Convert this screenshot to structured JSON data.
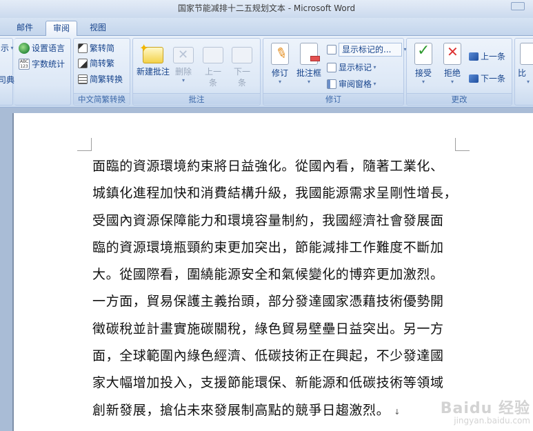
{
  "window": {
    "title": "国家节能减排十二五规划文本 - Microsoft Word"
  },
  "tabs": [
    {
      "label": "邮件"
    },
    {
      "label": "审阅",
      "active": true
    },
    {
      "label": "视图"
    }
  ],
  "ribbon": {
    "left_partial": {
      "item1": "示",
      "item2": "司典"
    },
    "proofing": {
      "language": "设置语言",
      "word_count": "字数统计"
    },
    "chinese_conversion": {
      "to_traditional": "繁转简",
      "to_simplified": "简转繁",
      "convert": "简繁转换",
      "group_label": "中文简繁转换"
    },
    "comments": {
      "new_comment": "新建批注",
      "delete": "删除",
      "previous": "上一条",
      "next": "下一条",
      "group_label": "批注"
    },
    "tracking": {
      "track_changes": "修订",
      "balloons": "批注框",
      "display_dropdown": "显示标记的...",
      "show_markup": "显示标记",
      "reviewing_pane": "审阅窗格",
      "group_label": "修订"
    },
    "changes": {
      "accept": "接受",
      "reject": "拒绝",
      "previous": "上一条",
      "next": "下一条",
      "group_label": "更改"
    },
    "compare_partial": {
      "label": "比"
    }
  },
  "document": {
    "lines": [
      "面臨的資源環境約束將日益強化。從國內看，隨著工業化、",
      "城鎮化進程加快和消費結構升級，我國能源需求呈剛性增長，",
      "受國內資源保障能力和環境容量制約，我國經濟社會發展面",
      "臨的資源環境瓶頸約束更加突出，節能減排工作難度不斷加",
      "大。從國際看，圍繞能源安全和氣候變化的博弈更加激烈。",
      "一方面，貿易保護主義抬頭，部分發達國家憑藉技術優勢開",
      "徵碳稅並計畫實施碳關稅，綠色貿易壁壘日益突出。另一方",
      "面，全球範圍內綠色經濟、低碳技術正在興起，不少發達國",
      "家大幅增加投入，支援節能環保、新能源和低碳技術等領域",
      "創新發展，搶佔未來發展制高點的競爭日趨激烈。"
    ],
    "paragraph_mark": "↓"
  },
  "watermark": {
    "line1": "Baidu 经验",
    "line2": "jingyan.baidu.com"
  },
  "colors": {
    "ribbon_text": "#15428b",
    "group_label": "#3e6aaa",
    "document_text": "#111111",
    "workspace_bg": "#a9bcd6"
  },
  "icons": {
    "language": "globe-icon",
    "word_count": "abc-123-icon",
    "new_comment": "comment-star-icon",
    "track_changes": "pencil-doc-icon",
    "accept": "check-doc-icon",
    "reject": "cross-doc-icon"
  }
}
